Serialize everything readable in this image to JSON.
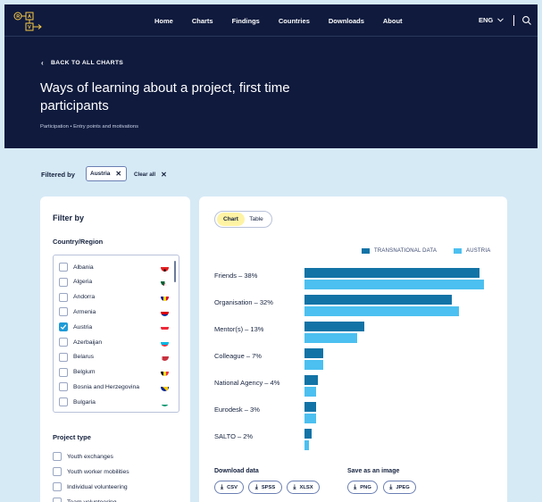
{
  "nav": {
    "logo_alt": "R-A V",
    "items": [
      {
        "label": "Home"
      },
      {
        "label": "Charts"
      },
      {
        "label": "Findings"
      },
      {
        "label": "Countries"
      },
      {
        "label": "Downloads"
      },
      {
        "label": "About"
      }
    ],
    "language": "ENG"
  },
  "hero": {
    "back_label": "BACK TO ALL CHARTS",
    "title": "Ways of learning about a project, first time participants",
    "breadcrumb": "Participation • Entry points and motivations"
  },
  "filter_bar": {
    "label": "Filtered by",
    "chip": "Austria",
    "clear_all": "Clear all"
  },
  "filters": {
    "title": "Filter by",
    "country_title": "Country/Region",
    "countries": [
      {
        "name": "Albania",
        "checked": false,
        "flag": "albania-flag-icon"
      },
      {
        "name": "Algeria",
        "checked": false,
        "flag": "algeria-flag-icon"
      },
      {
        "name": "Andorra",
        "checked": false,
        "flag": "andorra-flag-icon"
      },
      {
        "name": "Armenia",
        "checked": false,
        "flag": "armenia-flag-icon"
      },
      {
        "name": "Austria",
        "checked": true,
        "flag": "austria-flag-icon"
      },
      {
        "name": "Azerbaijan",
        "checked": false,
        "flag": "azerbaijan-flag-icon"
      },
      {
        "name": "Belarus",
        "checked": false,
        "flag": "belarus-flag-icon"
      },
      {
        "name": "Belgium",
        "checked": false,
        "flag": "belgium-flag-icon"
      },
      {
        "name": "Bosnia and Herzegovina",
        "checked": false,
        "flag": "bosnia-flag-icon"
      },
      {
        "name": "Bulgaria",
        "checked": false,
        "flag": "bulgaria-flag-icon"
      }
    ],
    "project_type_title": "Project type",
    "project_types": [
      {
        "name": "Youth exchanges",
        "checked": false
      },
      {
        "name": "Youth worker mobilities",
        "checked": false
      },
      {
        "name": "Individual volunteering",
        "checked": false
      },
      {
        "name": "Team volunteering",
        "checked": false
      }
    ]
  },
  "view_toggle": {
    "chart_label": "Chart",
    "table_label": "Table",
    "active": "Chart"
  },
  "colors": {
    "navy": "#0f1a3d",
    "transnational": "#1273a6",
    "austria": "#4cc0f0",
    "background": "#d6eaf6",
    "active_toggle": "#fef3a4"
  },
  "chart_data": {
    "type": "bar",
    "orientation": "horizontal",
    "categories": [
      "Friends – 38%",
      "Organisation – 32%",
      "Mentor(s) – 13%",
      "Colleague – 7%",
      "National Agency – 4%",
      "Eurodesk – 3%",
      "SALTO – 2%"
    ],
    "series": [
      {
        "name": "TRANSNATIONAL DATA",
        "values": [
          38,
          32,
          13,
          4,
          3,
          2.5,
          1.5
        ]
      },
      {
        "name": "AUSTRIA",
        "values": [
          39,
          33.5,
          11.5,
          4,
          2.5,
          2.5,
          1
        ]
      }
    ],
    "legend_position": "top-right",
    "grid": false,
    "xlim": [
      0,
      40
    ]
  },
  "download": {
    "data_title": "Download data",
    "data_buttons": [
      "CSV",
      "SPSS",
      "XLSX"
    ],
    "image_title": "Save as an image",
    "image_buttons": [
      "PNG",
      "JPEG"
    ]
  }
}
